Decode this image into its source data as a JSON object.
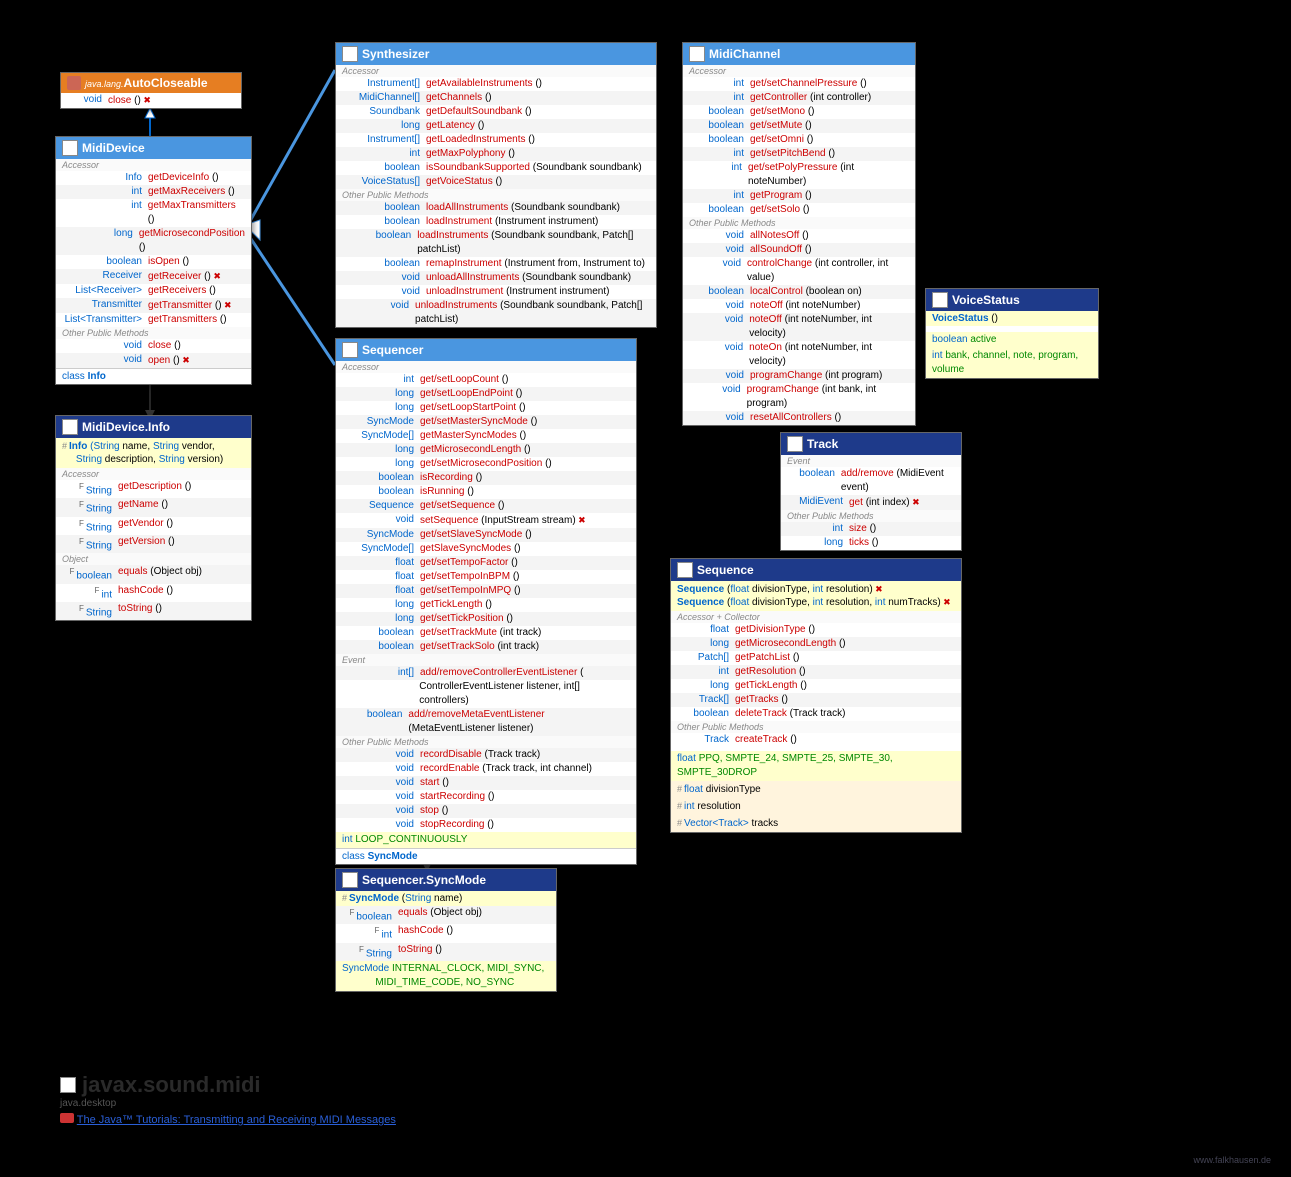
{
  "autoCloseable": {
    "title": "AutoCloseable",
    "pkg": "java.lang.",
    "rows": [
      [
        "void",
        "close",
        "()",
        " ✖"
      ]
    ]
  },
  "midiDevice": {
    "title": "MidiDevice",
    "sections": [
      {
        "h": "Accessor",
        "rows": [
          [
            "Info",
            "getDeviceInfo",
            "()",
            ""
          ],
          [
            "int",
            "getMaxReceivers",
            "()",
            ""
          ],
          [
            "int",
            "getMaxTransmitters",
            "()",
            ""
          ],
          [
            "long",
            "getMicrosecondPosition",
            "()",
            ""
          ],
          [
            "boolean",
            "isOpen",
            "()",
            ""
          ],
          [
            "Receiver",
            "getReceiver",
            "()",
            " ✖"
          ],
          [
            "List<Receiver>",
            "getReceivers",
            "()",
            ""
          ],
          [
            "Transmitter",
            "getTransmitter",
            "()",
            " ✖"
          ],
          [
            "List<Transmitter>",
            "getTransmitters",
            "()",
            ""
          ]
        ]
      },
      {
        "h": "Other Public Methods",
        "rows": [
          [
            "void",
            "close",
            "()",
            ""
          ],
          [
            "void",
            "open",
            "()",
            " ✖"
          ]
        ]
      }
    ],
    "nested": "class Info"
  },
  "midiDeviceInfo": {
    "title": "MidiDevice.Info",
    "ctor": [
      "# Info",
      "(String name, String vendor,",
      "String description, String version)"
    ],
    "sections": [
      {
        "h": "Accessor",
        "rows": [
          [
            "String",
            "getDescription",
            "()",
            "F"
          ],
          [
            "String",
            "getName",
            "()",
            "F"
          ],
          [
            "String",
            "getVendor",
            "()",
            "F"
          ],
          [
            "String",
            "getVersion",
            "()",
            "F"
          ]
        ]
      },
      {
        "h": "Object",
        "rows": [
          [
            "boolean",
            "equals",
            "(Object obj)",
            "F"
          ],
          [
            "int",
            "hashCode",
            "()",
            "F"
          ],
          [
            "String",
            "toString",
            "()",
            "F"
          ]
        ]
      }
    ]
  },
  "synthesizer": {
    "title": "Synthesizer",
    "sections": [
      {
        "h": "Accessor",
        "rows": [
          [
            "Instrument[]",
            "getAvailableInstruments",
            "()",
            ""
          ],
          [
            "MidiChannel[]",
            "getChannels",
            "()",
            ""
          ],
          [
            "Soundbank",
            "getDefaultSoundbank",
            "()",
            ""
          ],
          [
            "long",
            "getLatency",
            "()",
            ""
          ],
          [
            "Instrument[]",
            "getLoadedInstruments",
            "()",
            ""
          ],
          [
            "int",
            "getMaxPolyphony",
            "()",
            ""
          ],
          [
            "boolean",
            "isSoundbankSupported",
            "(Soundbank soundbank)",
            ""
          ],
          [
            "VoiceStatus[]",
            "getVoiceStatus",
            "()",
            ""
          ]
        ]
      },
      {
        "h": "Other Public Methods",
        "rows": [
          [
            "boolean",
            "loadAllInstruments",
            "(Soundbank soundbank)",
            ""
          ],
          [
            "boolean",
            "loadInstrument",
            "(Instrument instrument)",
            ""
          ],
          [
            "boolean",
            "loadInstruments",
            "(Soundbank soundbank, Patch[] patchList)",
            ""
          ],
          [
            "boolean",
            "remapInstrument",
            "(Instrument from, Instrument to)",
            ""
          ],
          [
            "void",
            "unloadAllInstruments",
            "(Soundbank soundbank)",
            ""
          ],
          [
            "void",
            "unloadInstrument",
            "(Instrument instrument)",
            ""
          ],
          [
            "void",
            "unloadInstruments",
            "(Soundbank soundbank, Patch[] patchList)",
            ""
          ]
        ]
      }
    ]
  },
  "sequencer": {
    "title": "Sequencer",
    "sections": [
      {
        "h": "Accessor",
        "rows": [
          [
            "int",
            "get/setLoopCount",
            "()",
            ""
          ],
          [
            "long",
            "get/setLoopEndPoint",
            "()",
            ""
          ],
          [
            "long",
            "get/setLoopStartPoint",
            "()",
            ""
          ],
          [
            "SyncMode",
            "get/setMasterSyncMode",
            "()",
            ""
          ],
          [
            "SyncMode[]",
            "getMasterSyncModes",
            "()",
            ""
          ],
          [
            "long",
            "getMicrosecondLength",
            "()",
            ""
          ],
          [
            "long",
            "get/setMicrosecondPosition",
            "()",
            ""
          ],
          [
            "boolean",
            "isRecording",
            "()",
            ""
          ],
          [
            "boolean",
            "isRunning",
            "()",
            ""
          ],
          [
            "Sequence",
            "get/setSequence",
            "()",
            ""
          ],
          [
            "void",
            "setSequence",
            "(InputStream stream)",
            " ✖"
          ],
          [
            "SyncMode",
            "get/setSlaveSyncMode",
            "()",
            ""
          ],
          [
            "SyncMode[]",
            "getSlaveSyncModes",
            "()",
            ""
          ],
          [
            "float",
            "get/setTempoFactor",
            "()",
            ""
          ],
          [
            "float",
            "get/setTempoInBPM",
            "()",
            ""
          ],
          [
            "float",
            "get/setTempoInMPQ",
            "()",
            ""
          ],
          [
            "long",
            "getTickLength",
            "()",
            ""
          ],
          [
            "long",
            "get/setTickPosition",
            "()",
            ""
          ],
          [
            "boolean",
            "get/setTrackMute",
            "(int track)",
            ""
          ],
          [
            "boolean",
            "get/setTrackSolo",
            "(int track)",
            ""
          ]
        ]
      },
      {
        "h": "Event",
        "rows": [
          [
            "int[]",
            "add/removeControllerEventListener",
            "(",
            ""
          ],
          [
            "",
            "",
            "ControllerEventListener listener, int[] controllers)",
            ""
          ],
          [
            "boolean",
            "add/removeMetaEventListener",
            "(MetaEventListener listener)",
            ""
          ]
        ]
      },
      {
        "h": "Other Public Methods",
        "rows": [
          [
            "void",
            "recordDisable",
            "(Track track)",
            ""
          ],
          [
            "void",
            "recordEnable",
            "(Track track, int channel)",
            ""
          ],
          [
            "void",
            "start",
            "()",
            ""
          ],
          [
            "void",
            "startRecording",
            "()",
            ""
          ],
          [
            "void",
            "stop",
            "()",
            ""
          ],
          [
            "void",
            "stopRecording",
            "()",
            ""
          ]
        ]
      }
    ],
    "consts": "int LOOP_CONTINUOUSLY",
    "nested": "class SyncMode"
  },
  "syncMode": {
    "title": "Sequencer.SyncMode",
    "ctor": [
      "# SyncMode",
      "(String name)"
    ],
    "sections": [
      {
        "h": "",
        "rows": [
          [
            "boolean",
            "equals",
            "(Object obj)",
            "F"
          ],
          [
            "int",
            "hashCode",
            "()",
            "F"
          ],
          [
            "String",
            "toString",
            "()",
            "F"
          ]
        ]
      }
    ],
    "consts": "SyncMode INTERNAL_CLOCK, MIDI_SYNC,",
    "consts2": "MIDI_TIME_CODE, NO_SYNC"
  },
  "midiChannel": {
    "title": "MidiChannel",
    "sections": [
      {
        "h": "Accessor",
        "rows": [
          [
            "int",
            "get/setChannelPressure",
            "()",
            ""
          ],
          [
            "int",
            "getController",
            "(int controller)",
            ""
          ],
          [
            "boolean",
            "get/setMono",
            "()",
            ""
          ],
          [
            "boolean",
            "get/setMute",
            "()",
            ""
          ],
          [
            "boolean",
            "get/setOmni",
            "()",
            ""
          ],
          [
            "int",
            "get/setPitchBend",
            "()",
            ""
          ],
          [
            "int",
            "get/setPolyPressure",
            "(int noteNumber)",
            ""
          ],
          [
            "int",
            "getProgram",
            "()",
            ""
          ],
          [
            "boolean",
            "get/setSolo",
            "()",
            ""
          ]
        ]
      },
      {
        "h": "Other Public Methods",
        "rows": [
          [
            "void",
            "allNotesOff",
            "()",
            ""
          ],
          [
            "void",
            "allSoundOff",
            "()",
            ""
          ],
          [
            "void",
            "controlChange",
            "(int controller, int value)",
            ""
          ],
          [
            "boolean",
            "localControl",
            "(boolean on)",
            ""
          ],
          [
            "void",
            "noteOff",
            "(int noteNumber)",
            ""
          ],
          [
            "void",
            "noteOff",
            "(int noteNumber, int velocity)",
            ""
          ],
          [
            "void",
            "noteOn",
            "(int noteNumber, int velocity)",
            ""
          ],
          [
            "void",
            "programChange",
            "(int program)",
            ""
          ],
          [
            "void",
            "programChange",
            "(int bank, int program)",
            ""
          ],
          [
            "void",
            "resetAllControllers",
            "()",
            ""
          ]
        ]
      }
    ]
  },
  "voiceStatus": {
    "title": "VoiceStatus",
    "ctor": [
      "VoiceStatus",
      "()"
    ],
    "fields": [
      [
        "boolean",
        "active"
      ],
      [
        "int",
        "bank, channel, note, program, volume"
      ]
    ]
  },
  "track": {
    "title": "Track",
    "sections": [
      {
        "h": "Event",
        "rows": [
          [
            "boolean",
            "add/remove",
            "(MidiEvent event)",
            ""
          ],
          [
            "MidiEvent",
            "get",
            "(int index)",
            " ✖"
          ]
        ]
      },
      {
        "h": "Other Public Methods",
        "rows": [
          [
            "int",
            "size",
            "()",
            ""
          ],
          [
            "long",
            "ticks",
            "()",
            ""
          ]
        ]
      }
    ]
  },
  "sequence": {
    "title": "Sequence",
    "ctors": [
      [
        "Sequence",
        "(float divisionType, int resolution)",
        " ✖"
      ],
      [
        "Sequence",
        "(float divisionType, int resolution, int numTracks)",
        " ✖"
      ]
    ],
    "sections": [
      {
        "h": "Accessor + Collector",
        "rows": [
          [
            "float",
            "getDivisionType",
            "()",
            ""
          ],
          [
            "long",
            "getMicrosecondLength",
            "()",
            ""
          ],
          [
            "Patch[]",
            "getPatchList",
            "()",
            ""
          ],
          [
            "int",
            "getResolution",
            "()",
            ""
          ],
          [
            "long",
            "getTickLength",
            "()",
            ""
          ],
          [
            "Track[]",
            "getTracks",
            "()",
            ""
          ],
          [
            "boolean",
            "deleteTrack",
            "(Track track)",
            ""
          ]
        ]
      },
      {
        "h": "Other Public Methods",
        "rows": [
          [
            "Track",
            "createTrack",
            "()",
            ""
          ]
        ]
      }
    ],
    "consts": "float PPQ, SMPTE_24, SMPTE_25, SMPTE_30, SMPTE_30DROP",
    "pfields": [
      "# float divisionType",
      "# int resolution",
      "# Vector<Track> tracks"
    ]
  },
  "footer": {
    "title": "javax.sound.midi",
    "sub": "java.desktop",
    "link": "The Java™ Tutorials: Transmitting and Receiving MIDI Messages",
    "credits": "www.falkhausen.de"
  }
}
